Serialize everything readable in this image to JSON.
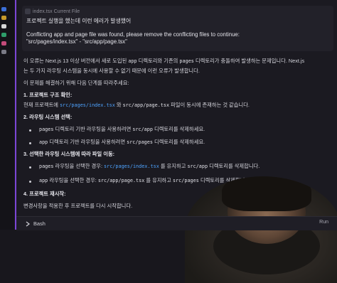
{
  "user_message": {
    "file_chip": "index.tsx Current File",
    "line1": "프로젝트 실행을 했는데 이런 에러가 발생했어",
    "line2": "Conflicting app and page file was found, please remove the conflicting files to continue:",
    "line3": "\"src/pages/index.tsx\" - \"src/app/page.tsx\""
  },
  "response": {
    "intro": {
      "p1": "이 오류는 Next.js 13 이상 버전에서 새로 도입된",
      "c1": "app",
      "p2": "디렉토리와 기존의",
      "c2": "pages",
      "p3": "디렉토리가 충돌하여 발생하는 문제입니다. Next.js"
    },
    "intro2": "는 두 가지 라우팅 시스템을 동시에 사용할 수 없기 때문에 이런 오류가 발생합니다.",
    "plan": "이 문제를 해결하기 위해 다음 단계를 따라주세요:",
    "step1": {
      "heading": "1. 프로젝트 구조 확인:",
      "p1": "현재 프로젝트에",
      "c1": "src/pages/index.tsx",
      "p2": "와",
      "c2": "src/app/page.tsx",
      "p3": "파일이 동시에 존재하는 것 같습니다."
    },
    "step2": {
      "heading": "2. 라우팅 시스템 선택:",
      "b1": {
        "c1": "pages",
        "p1": "디렉토리 기반 라우팅을 사용하려면",
        "c2": "src/app",
        "p2": "디렉토리를 삭제하세요."
      },
      "b2": {
        "c1": "app",
        "p1": "디렉토리 기반 라우팅을 사용하려면",
        "c2": "src/pages",
        "p2": "디렉토리를 삭제하세요."
      }
    },
    "step3": {
      "heading": "3. 선택한 라우팅 시스템에 따라 파일 이동:",
      "b1": {
        "c1": "pages",
        "p1": "라우팅을 선택한 경우:",
        "c2": "src/pages/index.tsx",
        "p2": "를 유지하고",
        "c3": "src/app",
        "p3": "디렉토리를 삭제합니다."
      },
      "b2": {
        "c1": "app",
        "p1": "라우팅을 선택한 경우:",
        "c2": "src/app/page.tsx",
        "p2": "를 유지하고",
        "c3": "src/pages",
        "p3": "디렉토리를 삭제합니다."
      }
    },
    "step4": {
      "heading": "4. 프로젝트 재시작:",
      "text": "변경사항을 적용한 후 프로젝트를 다시 시작합니다."
    }
  },
  "bottom_bar": {
    "bash_label": "Bash",
    "run_label": "Run"
  },
  "colors": {
    "accent_purple": "#7c46d6",
    "link_blue": "#4ea3ff",
    "background": "#1b1a21"
  }
}
